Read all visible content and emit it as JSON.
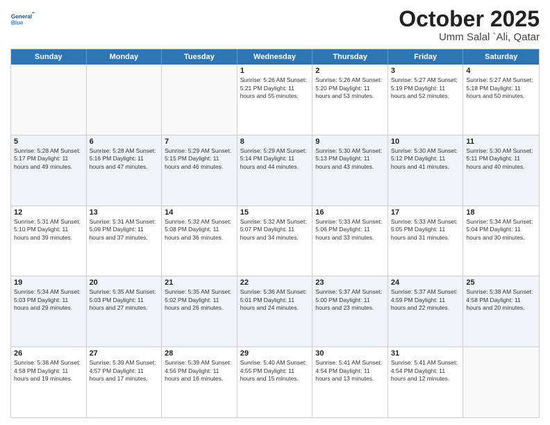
{
  "header": {
    "logo_line1": "General",
    "logo_line2": "Blue",
    "month": "October 2025",
    "location": "Umm Salal `Ali, Qatar"
  },
  "weekdays": [
    "Sunday",
    "Monday",
    "Tuesday",
    "Wednesday",
    "Thursday",
    "Friday",
    "Saturday"
  ],
  "rows": [
    [
      {
        "day": "",
        "info": ""
      },
      {
        "day": "",
        "info": ""
      },
      {
        "day": "",
        "info": ""
      },
      {
        "day": "1",
        "info": "Sunrise: 5:26 AM\nSunset: 5:21 PM\nDaylight: 11 hours\nand 55 minutes."
      },
      {
        "day": "2",
        "info": "Sunrise: 5:26 AM\nSunset: 5:20 PM\nDaylight: 11 hours\nand 53 minutes."
      },
      {
        "day": "3",
        "info": "Sunrise: 5:27 AM\nSunset: 5:19 PM\nDaylight: 11 hours\nand 52 minutes."
      },
      {
        "day": "4",
        "info": "Sunrise: 5:27 AM\nSunset: 5:18 PM\nDaylight: 11 hours\nand 50 minutes."
      }
    ],
    [
      {
        "day": "5",
        "info": "Sunrise: 5:28 AM\nSunset: 5:17 PM\nDaylight: 11 hours\nand 49 minutes."
      },
      {
        "day": "6",
        "info": "Sunrise: 5:28 AM\nSunset: 5:16 PM\nDaylight: 11 hours\nand 47 minutes."
      },
      {
        "day": "7",
        "info": "Sunrise: 5:29 AM\nSunset: 5:15 PM\nDaylight: 11 hours\nand 46 minutes."
      },
      {
        "day": "8",
        "info": "Sunrise: 5:29 AM\nSunset: 5:14 PM\nDaylight: 11 hours\nand 44 minutes."
      },
      {
        "day": "9",
        "info": "Sunrise: 5:30 AM\nSunset: 5:13 PM\nDaylight: 11 hours\nand 43 minutes."
      },
      {
        "day": "10",
        "info": "Sunrise: 5:30 AM\nSunset: 5:12 PM\nDaylight: 11 hours\nand 41 minutes."
      },
      {
        "day": "11",
        "info": "Sunrise: 5:30 AM\nSunset: 5:11 PM\nDaylight: 11 hours\nand 40 minutes."
      }
    ],
    [
      {
        "day": "12",
        "info": "Sunrise: 5:31 AM\nSunset: 5:10 PM\nDaylight: 11 hours\nand 39 minutes."
      },
      {
        "day": "13",
        "info": "Sunrise: 5:31 AM\nSunset: 5:09 PM\nDaylight: 11 hours\nand 37 minutes."
      },
      {
        "day": "14",
        "info": "Sunrise: 5:32 AM\nSunset: 5:08 PM\nDaylight: 11 hours\nand 36 minutes."
      },
      {
        "day": "15",
        "info": "Sunrise: 5:32 AM\nSunset: 5:07 PM\nDaylight: 11 hours\nand 34 minutes."
      },
      {
        "day": "16",
        "info": "Sunrise: 5:33 AM\nSunset: 5:06 PM\nDaylight: 11 hours\nand 33 minutes."
      },
      {
        "day": "17",
        "info": "Sunrise: 5:33 AM\nSunset: 5:05 PM\nDaylight: 11 hours\nand 31 minutes."
      },
      {
        "day": "18",
        "info": "Sunrise: 5:34 AM\nSunset: 5:04 PM\nDaylight: 11 hours\nand 30 minutes."
      }
    ],
    [
      {
        "day": "19",
        "info": "Sunrise: 5:34 AM\nSunset: 5:03 PM\nDaylight: 11 hours\nand 29 minutes."
      },
      {
        "day": "20",
        "info": "Sunrise: 5:35 AM\nSunset: 5:03 PM\nDaylight: 11 hours\nand 27 minutes."
      },
      {
        "day": "21",
        "info": "Sunrise: 5:35 AM\nSunset: 5:02 PM\nDaylight: 11 hours\nand 26 minutes."
      },
      {
        "day": "22",
        "info": "Sunrise: 5:36 AM\nSunset: 5:01 PM\nDaylight: 11 hours\nand 24 minutes."
      },
      {
        "day": "23",
        "info": "Sunrise: 5:37 AM\nSunset: 5:00 PM\nDaylight: 11 hours\nand 23 minutes."
      },
      {
        "day": "24",
        "info": "Sunrise: 5:37 AM\nSunset: 4:59 PM\nDaylight: 11 hours\nand 22 minutes."
      },
      {
        "day": "25",
        "info": "Sunrise: 5:38 AM\nSunset: 4:58 PM\nDaylight: 11 hours\nand 20 minutes."
      }
    ],
    [
      {
        "day": "26",
        "info": "Sunrise: 5:38 AM\nSunset: 4:58 PM\nDaylight: 11 hours\nand 19 minutes."
      },
      {
        "day": "27",
        "info": "Sunrise: 5:39 AM\nSunset: 4:57 PM\nDaylight: 11 hours\nand 17 minutes."
      },
      {
        "day": "28",
        "info": "Sunrise: 5:39 AM\nSunset: 4:56 PM\nDaylight: 11 hours\nand 16 minutes."
      },
      {
        "day": "29",
        "info": "Sunrise: 5:40 AM\nSunset: 4:55 PM\nDaylight: 11 hours\nand 15 minutes."
      },
      {
        "day": "30",
        "info": "Sunrise: 5:41 AM\nSunset: 4:54 PM\nDaylight: 11 hours\nand 13 minutes."
      },
      {
        "day": "31",
        "info": "Sunrise: 5:41 AM\nSunset: 4:54 PM\nDaylight: 11 hours\nand 12 minutes."
      },
      {
        "day": "",
        "info": ""
      }
    ]
  ]
}
